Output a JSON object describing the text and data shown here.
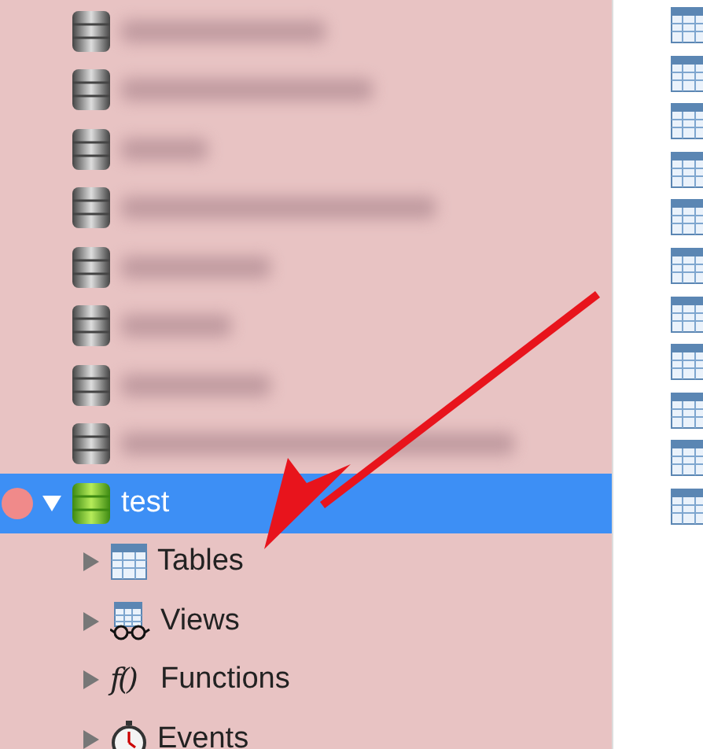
{
  "databases": [
    {
      "kind": "redacted",
      "selected": false
    },
    {
      "kind": "redacted",
      "selected": false
    },
    {
      "kind": "redacted",
      "selected": false
    },
    {
      "kind": "redacted",
      "selected": false
    },
    {
      "kind": "redacted",
      "selected": false
    },
    {
      "kind": "redacted",
      "selected": false
    },
    {
      "kind": "redacted",
      "selected": false
    },
    {
      "kind": "redacted",
      "selected": false
    },
    {
      "kind": "named",
      "name": "test",
      "selected": true,
      "expanded": true,
      "children": [
        {
          "kind": "tables",
          "label": "Tables",
          "expanded": false
        },
        {
          "kind": "views",
          "label": "Views",
          "expanded": false
        },
        {
          "kind": "functions",
          "label": "Functions",
          "glyph": "f()",
          "expanded": false
        },
        {
          "kind": "events",
          "label": "Events",
          "expanded": false
        }
      ]
    }
  ],
  "table_list": [
    {
      "kind": "table"
    },
    {
      "kind": "table"
    },
    {
      "kind": "table"
    },
    {
      "kind": "table"
    },
    {
      "kind": "table"
    },
    {
      "kind": "table"
    },
    {
      "kind": "table"
    },
    {
      "kind": "table"
    },
    {
      "kind": "table"
    },
    {
      "kind": "table"
    },
    {
      "kind": "table"
    }
  ]
}
